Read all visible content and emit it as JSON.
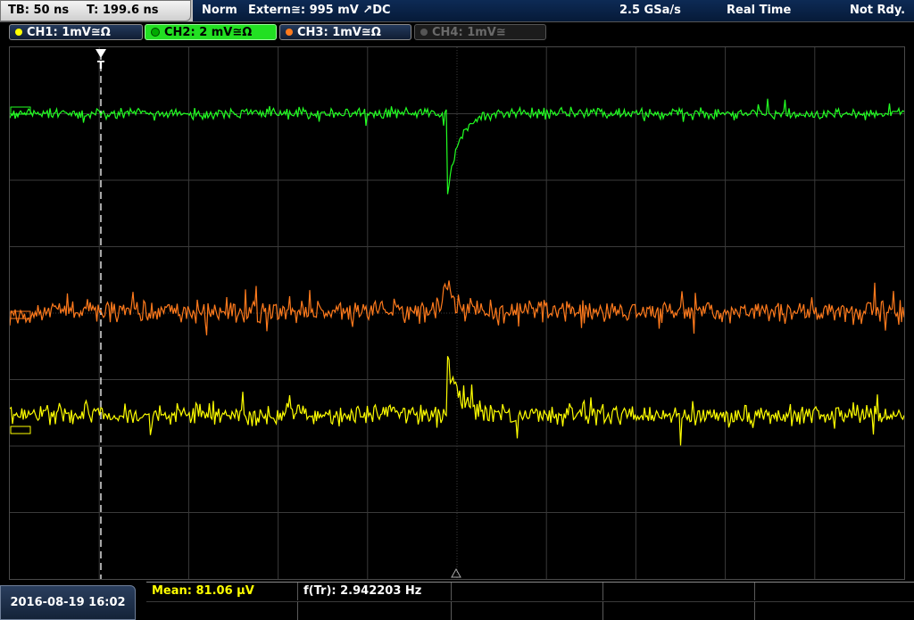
{
  "header": {
    "timebase": "TB: 50 ns",
    "trigger_time": "T: 199.6 ns",
    "trigger_mode": "Norm",
    "trigger_source": "Extern≅: 995 mV ↗DC",
    "sample_rate": "2.5 GSa/s",
    "acq_mode": "Real Time",
    "status": "Not Rdy."
  },
  "channels": [
    {
      "label": "CH1: 1mV≅Ω",
      "color": "#ffff00",
      "state": "on"
    },
    {
      "label": "CH2: 2 mV≅Ω",
      "color": "#22ff22",
      "state": "active"
    },
    {
      "label": "CH3: 1mV≅Ω",
      "color": "#ff7a1c",
      "state": "on"
    },
    {
      "label": "CH4: 1mV≅",
      "color": "#666666",
      "state": "off"
    }
  ],
  "traces": {
    "ch2_color": "#22ff22",
    "ch3_color": "#ff7a1c",
    "ch1_color": "#ffff00"
  },
  "footer": {
    "datetime": "2016-08-19 16:02",
    "mean": "Mean: 81.06 µV",
    "frequency": "f(Tr): 2.942203 Hz",
    "mean_color": "#ffff00",
    "frequency_color": "#ffffff"
  }
}
